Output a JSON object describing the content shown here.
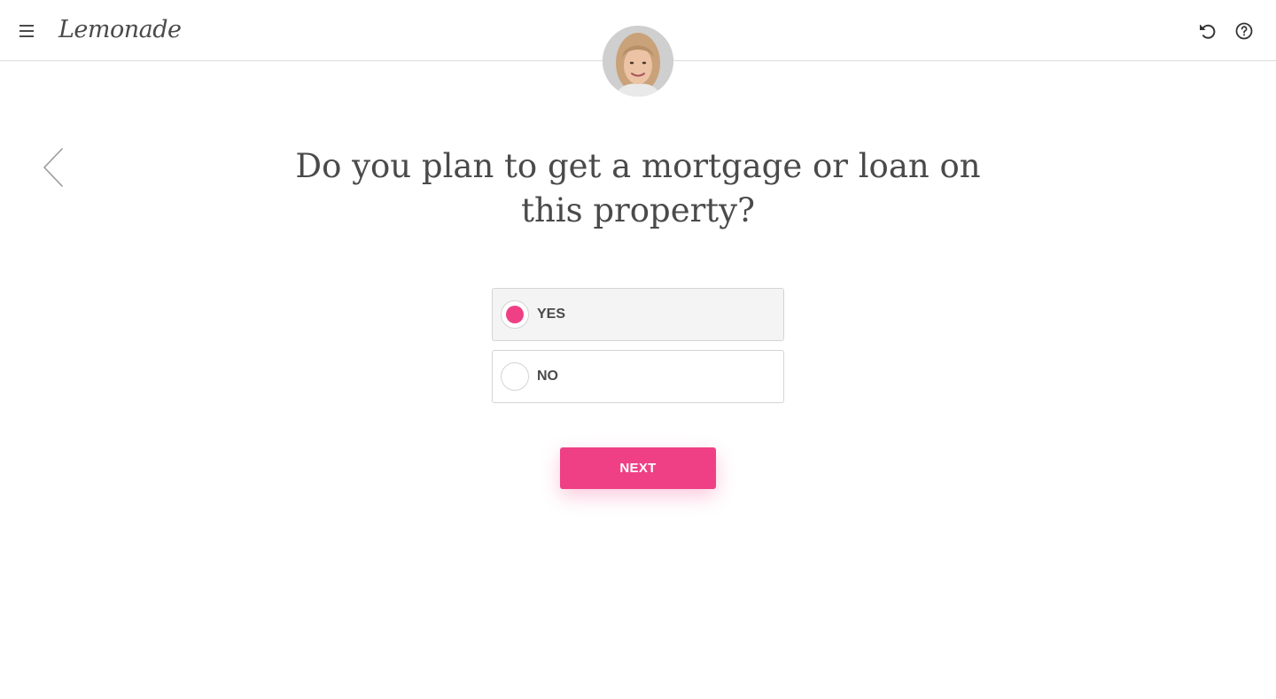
{
  "app": {
    "logo_text": "Lemonade"
  },
  "header": {
    "menu_icon": "hamburger-menu-icon",
    "restart_icon": "restart-icon",
    "help_icon": "help-circle-icon"
  },
  "agent": {
    "avatar": "agent-avatar-photo"
  },
  "nav": {
    "back_icon": "chevron-left-icon"
  },
  "question": {
    "text": "Do you plan to get a mortgage or loan on this property?"
  },
  "options": [
    {
      "label": "YES",
      "selected": true
    },
    {
      "label": "NO",
      "selected": false
    }
  ],
  "next_button": {
    "label": "NEXT"
  },
  "colors": {
    "accent": "#ef4086",
    "text": "#4a4a4a",
    "border": "#d4d4d4",
    "selected_bg": "#f4f4f4"
  }
}
